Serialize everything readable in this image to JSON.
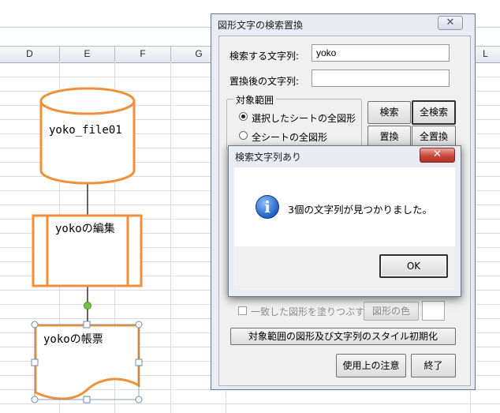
{
  "spreadsheet": {
    "columns": [
      "D",
      "E",
      "F",
      "G",
      "L"
    ]
  },
  "shapes": {
    "database_label": "yoko_file01",
    "process_label": "yokoの編集",
    "document_label": "yokoの帳票"
  },
  "search_dialog": {
    "title": "図形文字の検索置換",
    "close_glyph": "✕",
    "search_label": "検索する文字列:",
    "search_value": "yoko",
    "replace_label": "置換後の文字列:",
    "replace_value": "",
    "scope_group": "対象範囲",
    "scope_options": [
      "選択したシートの全図形",
      "全シートの全図形"
    ],
    "search_button": "検索",
    "search_all_button": "全検索",
    "replace_button": "置換",
    "replace_all_button": "全置換",
    "fill_matched_label": "一致した図形を塗りつぶす",
    "shape_color_button": "図形の色",
    "reset_style_button": "対象範囲の図形及び文字列のスタイル初期化",
    "usage_notes_button": "使用上の注意",
    "exit_button": "終了"
  },
  "message_box": {
    "title": "検索文字列あり",
    "close_glyph": "✕",
    "icon_glyph": "i",
    "message": "3個の文字列が見つかりました。",
    "ok_button": "OK"
  },
  "colors": {
    "shape_stroke": "#f0913a",
    "connector": "#000000",
    "handle_green": "#7cc242",
    "info_blue": "#1e62c7",
    "close_red": "#c9463a"
  }
}
